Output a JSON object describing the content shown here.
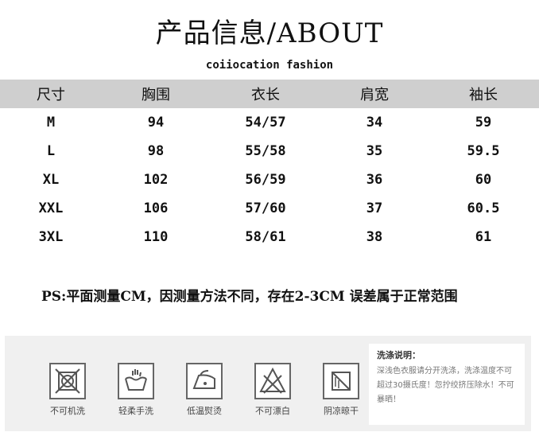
{
  "title": "产品信息/ABOUT",
  "subtitle": "coiiocation fashion",
  "size_table": {
    "headers": [
      "尺寸",
      "胸围",
      "衣长",
      "肩宽",
      "袖长"
    ],
    "rows": [
      [
        "M",
        "94",
        "54/57",
        "34",
        "59"
      ],
      [
        "L",
        "98",
        "55/58",
        "35",
        "59.5"
      ],
      [
        "XL",
        "102",
        "56/59",
        "36",
        "60"
      ],
      [
        "XXL",
        "106",
        "57/60",
        "37",
        "60.5"
      ],
      [
        "3XL",
        "110",
        "58/61",
        "38",
        "61"
      ]
    ]
  },
  "ps_note": "PS:平面测量CM，因测量方法不同，存在2-3CM 误差属于正常范围",
  "care": {
    "icons": [
      {
        "icon": "no-machine-wash-icon",
        "label": "不可机洗"
      },
      {
        "icon": "gentle-hand-wash-icon",
        "label": "轻柔手洗"
      },
      {
        "icon": "low-temp-iron-icon",
        "label": "低温熨烫"
      },
      {
        "icon": "no-bleach-icon",
        "label": "不可漂白"
      },
      {
        "icon": "shade-dry-icon",
        "label": "阴凉晾干"
      }
    ],
    "note_title": "洗涤说明：",
    "note_text": "深浅色衣服请分开洗涤，洗涤温度不可超过30摄氏度！忽拧绞挤压除水！不可暴晒！"
  }
}
